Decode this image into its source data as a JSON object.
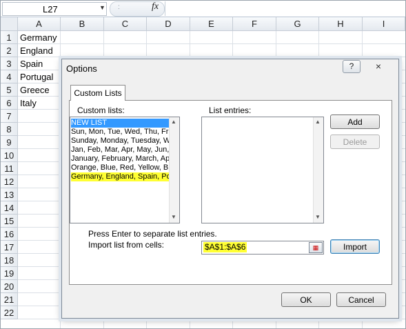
{
  "formula_bar": {
    "name_box": "L27",
    "fx_label": "fx",
    "dropdown_icon": "triangle-down",
    "dots": ":"
  },
  "columns": [
    "A",
    "B",
    "C",
    "D",
    "E",
    "F",
    "G",
    "H",
    "I"
  ],
  "rows": [
    "1",
    "2",
    "3",
    "4",
    "5",
    "6",
    "7",
    "8",
    "9",
    "10",
    "11",
    "12",
    "13",
    "14",
    "15",
    "16",
    "17",
    "18",
    "19",
    "20",
    "21",
    "22"
  ],
  "cells_A": [
    "Germany",
    "England",
    "Spain",
    "Portugal",
    "Greece",
    "Italy"
  ],
  "dialog": {
    "title": "Options",
    "help_icon": "?",
    "close_icon": "×",
    "tab_label": "Custom Lists",
    "custom_lists_label": "Custom lists:",
    "list_entries_label": "List entries:",
    "custom_lists": [
      "NEW LIST",
      "Sun, Mon, Tue, Wed, Thu, Fri, Sat",
      "Sunday, Monday, Tuesday, Wednesday",
      "Jan, Feb, Mar, Apr, May, Jun, Jul",
      "January, February, March, April",
      "Orange, Blue, Red, Yellow, Black",
      "Germany, England, Spain, Portugal"
    ],
    "add_button": "Add",
    "delete_button": "Delete",
    "hint": "Press Enter to separate list entries.",
    "import_label": "Import list from cells:",
    "import_value": "$A$1:$A$6",
    "import_button": "Import",
    "ok_button": "OK",
    "cancel_button": "Cancel"
  },
  "colors": {
    "selection": "#3399ff",
    "highlight": "#ffff33",
    "dialog_bg": "#f0f0f0"
  }
}
